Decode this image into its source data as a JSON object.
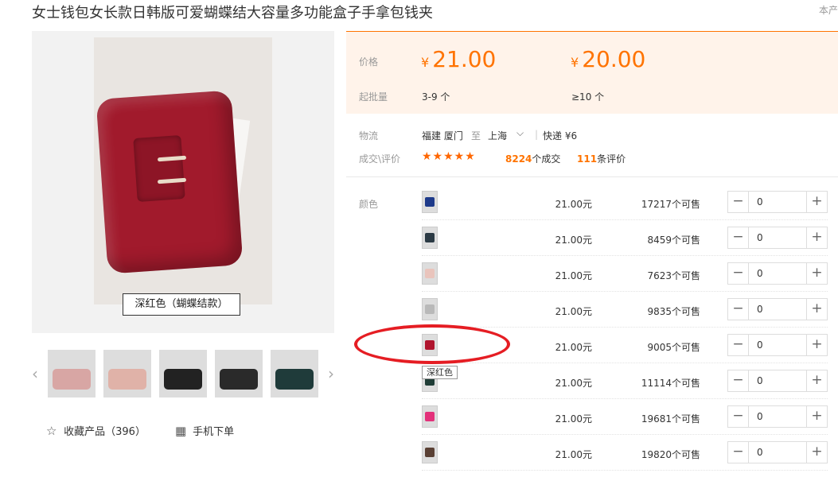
{
  "product": {
    "title": "女士钱包女长款日韩版可爱蝴蝶结大容量多功能盒子手拿包钱夹",
    "top_right_fragment": "本产",
    "image_caption": "深红色（蝴蝶结款）"
  },
  "thumbnails": [
    {
      "color": "#d8a6a4"
    },
    {
      "color": "#e0b2a8"
    },
    {
      "color": "#222222"
    },
    {
      "color": "#2a2a2a"
    },
    {
      "color": "#1f3b3a"
    }
  ],
  "actions": {
    "favorite": "收藏产品（396）",
    "mobile_order": "手机下单"
  },
  "price": {
    "label": "价格",
    "currency": "¥",
    "tier1": "21.00",
    "tier2": "20.00",
    "moq_label": "起批量",
    "moq1": "3-9 个",
    "moq2": "≥10 个"
  },
  "logistics": {
    "label": "物流",
    "from": "福建 厦门",
    "to_word": "至",
    "to": "上海",
    "chevron": "⌵",
    "separator": "|",
    "shipping": "快递 ¥6"
  },
  "reviews": {
    "label": "成交\\评价",
    "stars": "★★★★★",
    "deals_count": "8224",
    "deals_text": "个成交",
    "review_count": "111",
    "review_text": "条评价"
  },
  "sku": {
    "label": "颜色",
    "selected_tooltip": "深红色",
    "items": [
      {
        "color": "#1e3a8a",
        "price": "21.00元",
        "stock": "17217个可售",
        "qty": "0"
      },
      {
        "color": "#2b3a44",
        "price": "21.00元",
        "stock": "8459个可售",
        "qty": "0"
      },
      {
        "color": "#e9c4bc",
        "price": "21.00元",
        "stock": "7623个可售",
        "qty": "0"
      },
      {
        "color": "#b9b9b9",
        "price": "21.00元",
        "stock": "9835个可售",
        "qty": "0"
      },
      {
        "color": "#b0152e",
        "price": "21.00元",
        "stock": "9005个可售",
        "qty": "0"
      },
      {
        "color": "#1f3d36",
        "price": "21.00元",
        "stock": "11114个可售",
        "qty": "0"
      },
      {
        "color": "#e3317a",
        "price": "21.00元",
        "stock": "19681个可售",
        "qty": "0"
      },
      {
        "color": "#5a4034",
        "price": "21.00元",
        "stock": "19820个可售",
        "qty": "0"
      }
    ]
  },
  "stepper": {
    "minus": "−",
    "plus": "+"
  },
  "icons": {
    "star_outline": "☆",
    "qr": "▦",
    "arrow_left": "‹",
    "arrow_right": "›"
  }
}
